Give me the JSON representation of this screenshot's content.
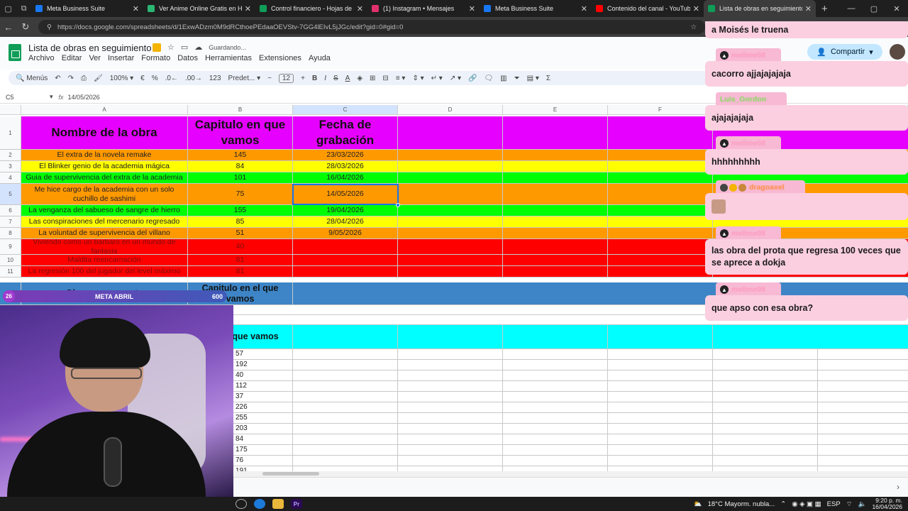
{
  "browser": {
    "tabs": [
      {
        "label": "Meta Business Suite",
        "color": "#1877f2"
      },
      {
        "label": "Ver Anime Online Gratis en HD y ...",
        "color": "#2bb673"
      },
      {
        "label": "Control financiero - Hojas de cálc...",
        "color": "#0f9d58"
      },
      {
        "label": "(1) Instagram • Mensajes",
        "color": "#e1306c"
      },
      {
        "label": "Meta Business Suite",
        "color": "#1877f2"
      },
      {
        "label": "Contenido del canal - YouTube St...",
        "color": "#ff0000"
      },
      {
        "label": "Lista de obras en seguimiento - H...",
        "color": "#0f9d58",
        "active": true
      }
    ],
    "url": "https://docs.google.com/spreadsheets/d/1ExwADzm0M9dRCthoePEdaaOEVStv-7GG4lEIvL5jJGc/edit?gid=0#gid=0"
  },
  "sheets": {
    "title": "Lista de obras en seguimiento",
    "saving": "Guardando...",
    "menus": [
      "Archivo",
      "Editar",
      "Ver",
      "Insertar",
      "Formato",
      "Datos",
      "Herramientas",
      "Extensiones",
      "Ayuda"
    ],
    "share": "Compartir",
    "toolbar": {
      "menus": "Menús",
      "zoom": "100%",
      "currency": "€",
      "percent": "%",
      "dec_dec": ".0←",
      "dec_inc": ".00→",
      "num": "123",
      "font": "Predet...",
      "font_size": "12"
    },
    "cell_ref": "C5",
    "formula": "14/05/2026",
    "columns": [
      "A",
      "B",
      "C",
      "D",
      "E",
      "F"
    ]
  },
  "grid": {
    "header_row": {
      "num": "1",
      "a": "Nombre de la obra",
      "b": "Capitulo en que vamos",
      "c": "Fecha de grabación"
    },
    "rows": [
      {
        "num": "2",
        "name": "El extra de la novela remake",
        "chapter": "145",
        "date": "23/03/2026",
        "color": "orange"
      },
      {
        "num": "3",
        "name": "El Blinker genio de la academia mágica",
        "chapter": "84",
        "date": "28/03/2026",
        "color": "yellow"
      },
      {
        "num": "4",
        "name": "Guia de supervivencia del extra de la academia",
        "chapter": "101",
        "date": "16/04/2026",
        "color": "green"
      },
      {
        "num": "5",
        "name": "Me hice cargo de la academia con un solo cuchillo de sashimi",
        "chapter": "75",
        "date": "14/05/2026",
        "color": "orange"
      },
      {
        "num": "6",
        "name": "La venganza del sabueso de sangre de hierro",
        "chapter": "155",
        "date": "19/04/2026",
        "color": "green"
      },
      {
        "num": "7",
        "name": "Las conspiraciones del mercenario regresado",
        "chapter": "85",
        "date": "28/04/2026",
        "color": "yellow"
      },
      {
        "num": "8",
        "name": "La voluntad de supervivencia del villano",
        "chapter": "51",
        "date": "9/05/2026",
        "color": "orange"
      },
      {
        "num": "9",
        "name": "Viviendo como un barbaro en un mundo de fantasia",
        "chapter": "40",
        "date": "",
        "color": "red"
      },
      {
        "num": "10",
        "name": "Maldita reencarnación",
        "chapter": "81",
        "date": "",
        "color": "red"
      },
      {
        "num": "11",
        "name": "La regresión 100 del jugador del level máximo",
        "chapter": "81",
        "date": "",
        "color": "red"
      }
    ],
    "blue_row": {
      "a": "Obra que c... meta",
      "b": "Capitulo en el que vamos"
    },
    "cyan_row": {
      "b": "o en el que vamos"
    },
    "lower_values": [
      "57",
      "192",
      "40",
      "112",
      "37",
      "226",
      "255",
      "203",
      "84",
      "175",
      "76",
      "191"
    ],
    "colors": {
      "magenta": "#e600ff",
      "orange": "#ff9900",
      "yellow": "#ffff00",
      "green": "#00ff00",
      "red": "#ff0000",
      "blue": "#3d85c6",
      "cyan": "#00ffff"
    }
  },
  "stream": {
    "meta": {
      "count": "26",
      "label": "META ABRIL",
      "goal": "600"
    },
    "chat": [
      {
        "text": "a Moisés le truena"
      },
      {
        "user": "mellme08",
        "text": "cacorro ajjajajajaja"
      },
      {
        "user": "Luis_Gordon",
        "text": "ajajajajaja"
      },
      {
        "user": "mellme08",
        "text": "hhhhhhhhh"
      },
      {
        "user": "dragoaxel",
        "text": ""
      },
      {
        "user": "mellme08",
        "text": "las obra del prota que regresa 100 veces que se aprece a dokja"
      },
      {
        "user": "mellme08",
        "text": "que apso con esa obra?"
      }
    ]
  },
  "taskbar": {
    "weather": "18°C  Mayorm. nubla...",
    "lang": "ESP",
    "time": "9:20 p. m.",
    "date": "16/04/2026"
  }
}
